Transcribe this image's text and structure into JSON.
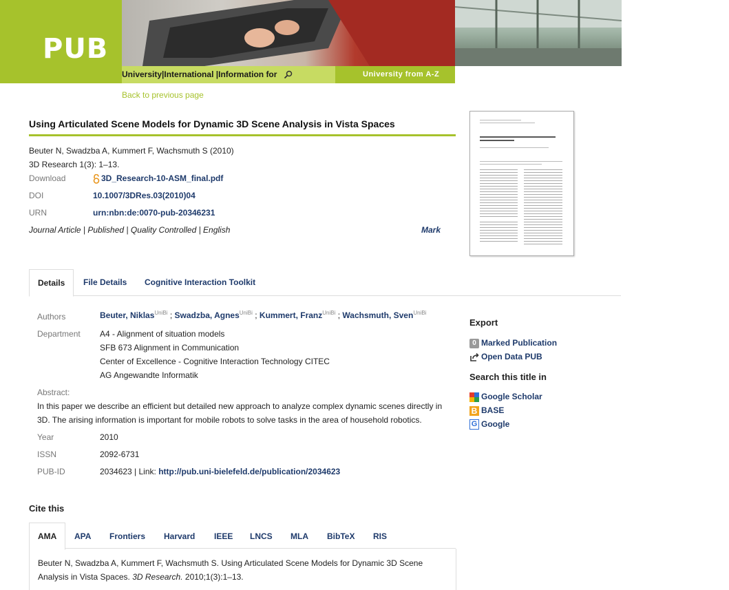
{
  "header": {
    "logo": "PUB",
    "nav": [
      "University",
      "International",
      "Information for"
    ],
    "nav_right": "University from A-Z"
  },
  "back_link": "Back to previous page",
  "publication": {
    "title": "Using Articulated Scene Models for Dynamic 3D Scene Analysis in Vista Spaces",
    "citation_short": "Beuter N, Swadzba A, Kummert F, Wachsmuth S (2010)",
    "journal_ref": "3D Research 1(3): 1–13.",
    "download_label": "Download",
    "download_file": "3D_Research-10-ASM_final.pdf",
    "doi_label": "DOI",
    "doi": "10.1007/3DRes.03(2010)04",
    "urn_label": "URN",
    "urn": "urn:nbn:de:0070-pub-20346231",
    "status": "Journal Article | Published | Quality Controlled | English",
    "mark": "Mark"
  },
  "tabs": [
    "Details",
    "File Details",
    "Cognitive Interaction Toolkit"
  ],
  "details": {
    "authors_label": "Authors",
    "authors": [
      {
        "name": "Beuter, Niklas",
        "aff": "UniBi"
      },
      {
        "name": "Swadzba, Agnes",
        "aff": "UniBi"
      },
      {
        "name": "Kummert, Franz",
        "aff": "UniBi"
      },
      {
        "name": "Wachsmuth, Sven",
        "aff": "UniBi"
      }
    ],
    "department_label": "Department",
    "departments": [
      "A4 - Alignment of situation models",
      "SFB 673 Alignment in Communication",
      "Center of Excellence - Cognitive Interaction Technology CITEC",
      "AG Angewandte Informatik"
    ],
    "abstract_label": "Abstract:",
    "abstract": "In this paper we describe an efficient but detailed new approach to analyze complex dynamic scenes directly in 3D. The arising information is important for mobile robots to solve tasks in the area of household robotics.",
    "year_label": "Year",
    "year": "2010",
    "issn_label": "ISSN",
    "issn": "2092-6731",
    "pubid_label": "PUB-ID",
    "pubid": "2034623 | Link: ",
    "pubid_link": "http://pub.uni-bielefeld.de/publication/2034623"
  },
  "sidebar": {
    "export_heading": "Export",
    "marked_count": "0",
    "marked_label": "Marked Publication",
    "opendata_label": "Open Data PUB",
    "search_heading": "Search this title in",
    "scholar": "Google Scholar",
    "base": "BASE",
    "google": "Google"
  },
  "cite": {
    "heading": "Cite this",
    "tabs": [
      "AMA",
      "APA",
      "Frontiers",
      "Harvard",
      "IEEE",
      "LNCS",
      "MLA",
      "BibTeX",
      "RIS"
    ],
    "text_prefix": "Beuter N, Swadzba A, Kummert F, Wachsmuth S. Using Articulated Scene Models for Dynamic 3D Scene Analysis in Vista Spaces. ",
    "text_journal": "3D Research.",
    "text_suffix": " 2010;1(3):1–13."
  },
  "colors": {
    "accent": "#a6c22c",
    "link": "#1e3a6b"
  }
}
